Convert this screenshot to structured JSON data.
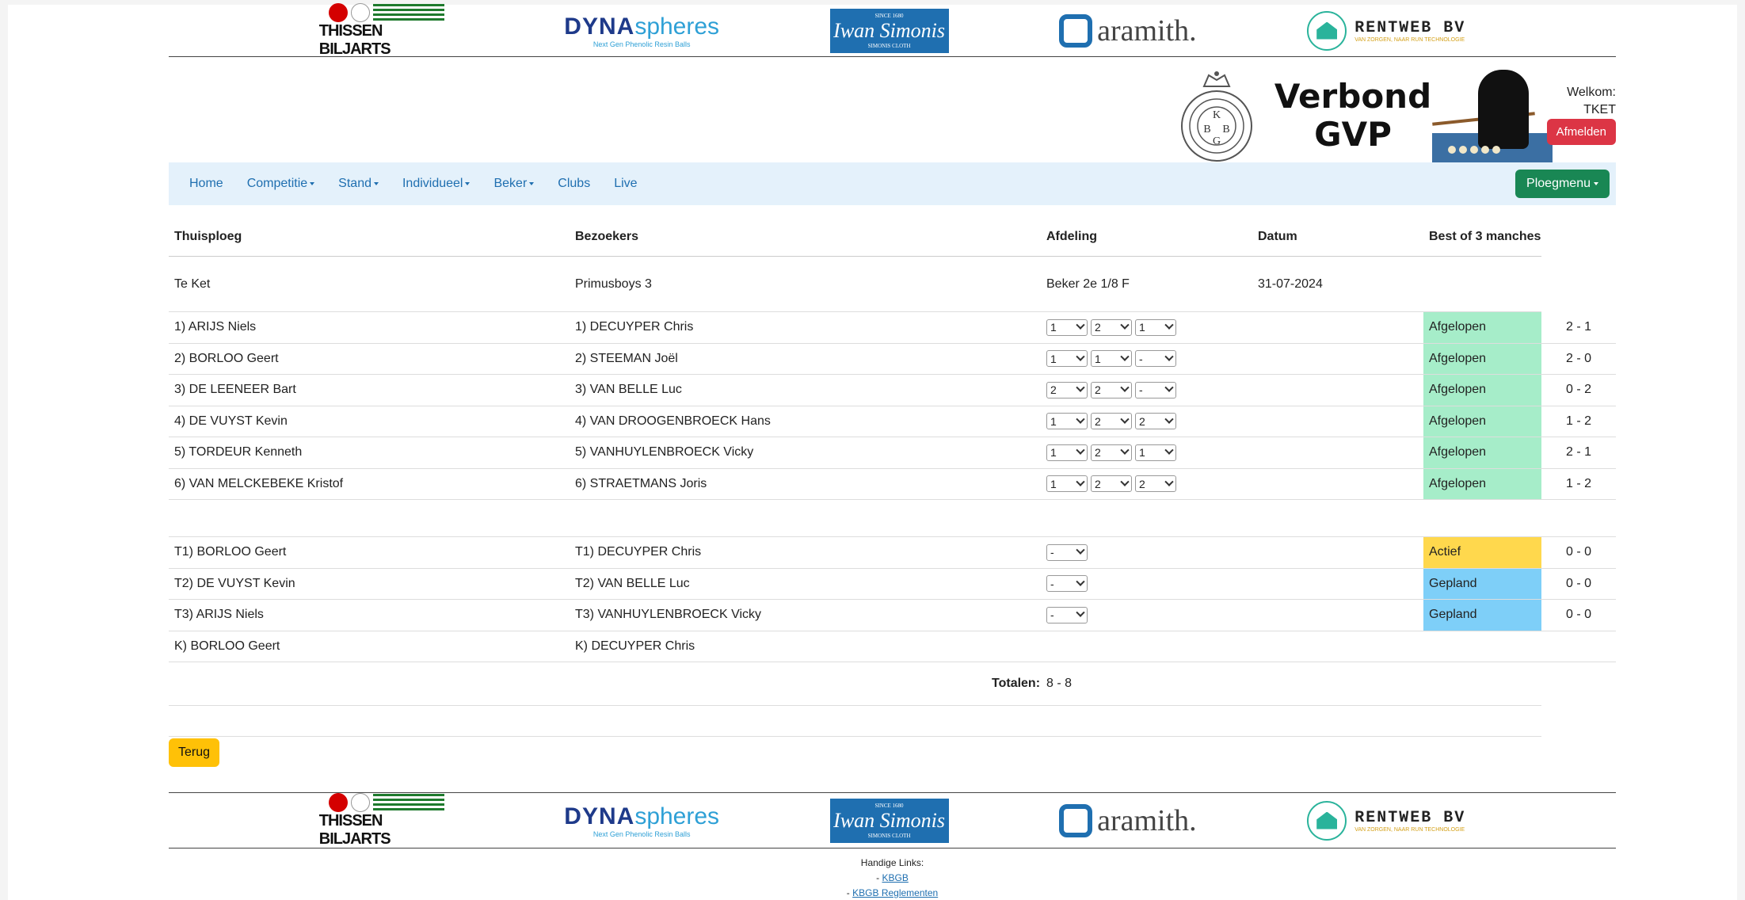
{
  "sponsors": {
    "thissen": "THISSEN BILJARTS",
    "dyna_a": "DYNA",
    "dyna_b": "spheres",
    "dyna_sub": "Next Gen Phenolic Resin Balls",
    "simonis_top": "SINCE 1680",
    "simonis_main": "Iwan Simonis",
    "simonis_bottom": "SIMONIS CLOTH",
    "aramith": "aramith.",
    "rentweb": "RENTWEB BV",
    "rentweb_sub": "VAN ZORGEN, NAAR RUN TECHNOLOGIE"
  },
  "header": {
    "brand_line1": "Verbond",
    "brand_line2": "GVP",
    "welcome_label": "Welkom:",
    "user": "TKET",
    "logout": "Afmelden"
  },
  "nav": {
    "items": [
      {
        "label": "Home",
        "dropdown": false
      },
      {
        "label": "Competitie",
        "dropdown": true
      },
      {
        "label": "Stand",
        "dropdown": true
      },
      {
        "label": "Individueel",
        "dropdown": true
      },
      {
        "label": "Beker",
        "dropdown": true
      },
      {
        "label": "Clubs",
        "dropdown": false
      },
      {
        "label": "Live",
        "dropdown": false
      }
    ],
    "team_menu": "Ploegmenu"
  },
  "table": {
    "headers": {
      "home": "Thuisploeg",
      "visitors": "Bezoekers",
      "division": "Afdeling",
      "date": "Datum",
      "format": "Best of 3 manches"
    },
    "match": {
      "home": "Te Ket",
      "visitors": "Primusboys 3",
      "division": "Beker 2e 1/8 F",
      "date": "31-07-2024"
    },
    "singles": [
      {
        "home": "1) ARIJS Niels",
        "visitor": "1) DECUYPER Chris",
        "sets": [
          "1",
          "2",
          "1"
        ],
        "status": "Afgelopen",
        "score": "2 - 1"
      },
      {
        "home": "2) BORLOO Geert",
        "visitor": "2) STEEMAN Joël",
        "sets": [
          "1",
          "1",
          "-"
        ],
        "status": "Afgelopen",
        "score": "2 - 0"
      },
      {
        "home": "3) DE LEENEER Bart",
        "visitor": "3) VAN BELLE Luc",
        "sets": [
          "2",
          "2",
          "-"
        ],
        "status": "Afgelopen",
        "score": "0 - 2"
      },
      {
        "home": "4) DE VUYST Kevin",
        "visitor": "4) VAN DROOGENBROECK Hans",
        "sets": [
          "1",
          "2",
          "2"
        ],
        "status": "Afgelopen",
        "score": "1 - 2"
      },
      {
        "home": "5) TORDEUR Kenneth",
        "visitor": "5) VANHUYLENBROECK Vicky",
        "sets": [
          "1",
          "2",
          "1"
        ],
        "status": "Afgelopen",
        "score": "2 - 1"
      },
      {
        "home": "6) VAN MELCKEBEKE Kristof",
        "visitor": "6) STRAETMANS Joris",
        "sets": [
          "1",
          "2",
          "2"
        ],
        "status": "Afgelopen",
        "score": "1 - 2"
      }
    ],
    "team": [
      {
        "home": "T1) BORLOO Geert",
        "visitor": "T1) DECUYPER Chris",
        "set": "-",
        "status": "Actief",
        "score": "0 - 0"
      },
      {
        "home": "T2) DE VUYST Kevin",
        "visitor": "T2) VAN BELLE Luc",
        "set": "-",
        "status": "Gepland",
        "score": "0 - 0"
      },
      {
        "home": "T3) ARIJS Niels",
        "visitor": "T3) VANHUYLENBROECK Vicky",
        "set": "-",
        "status": "Gepland",
        "score": "0 - 0"
      }
    ],
    "captains": {
      "home": "K) BORLOO Geert",
      "visitor": "K) DECUYPER Chris"
    },
    "totals_label": "Totalen:",
    "totals_value": "8 - 8"
  },
  "back_button": "Terug",
  "footer": {
    "links_title": "Handige Links:",
    "links": [
      "KBGB",
      "KBGB Reglementen"
    ]
  },
  "colors": {
    "afgelopen": "#a6edc9",
    "actief": "#ffd84d",
    "gepland": "#7ecff8",
    "navbar_bg": "#e4f1fb",
    "logout": "#dc3545",
    "team_menu": "#198754",
    "back": "#ffc107"
  }
}
